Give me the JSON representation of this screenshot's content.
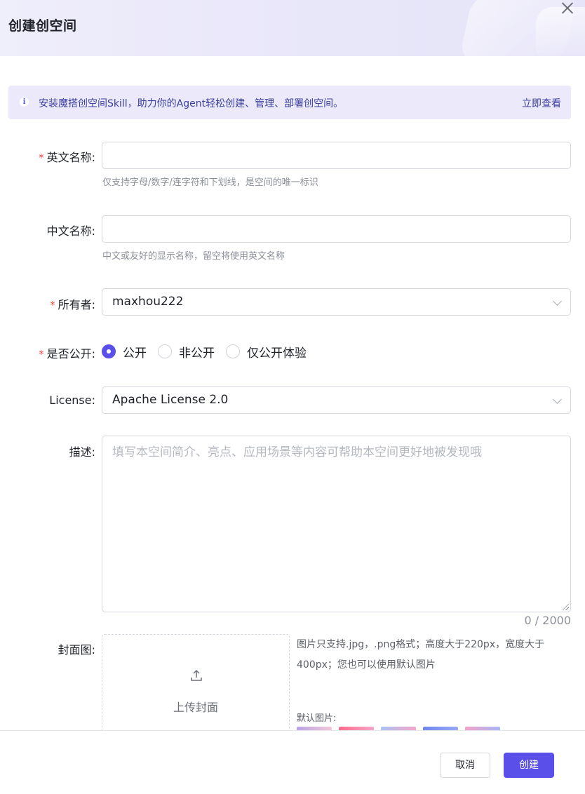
{
  "dialog": {
    "title": "创建创空间"
  },
  "notice": {
    "icon": "info-icon",
    "text": "安装魔搭创空间Skill，助力你的Agent轻松创建、管理、部署创空间。",
    "link": "立即查看"
  },
  "form": {
    "english_name": {
      "label": "英文名称:",
      "required": "*",
      "value": "",
      "hint": "仅支持字母/数字/连字符和下划线，是空间的唯一标识"
    },
    "chinese_name": {
      "label": "中文名称:",
      "value": "",
      "hint": "中文或友好的显示名称，留空将使用英文名称"
    },
    "owner": {
      "label": "所有者:",
      "required": "*",
      "value": "maxhou222"
    },
    "visibility": {
      "label": "是否公开:",
      "required": "*",
      "options": [
        "公开",
        "非公开",
        "仅公开体验"
      ],
      "selected": "公开"
    },
    "license": {
      "label": "License:",
      "value": "Apache License 2.0"
    },
    "description": {
      "label": "描述:",
      "placeholder": "填写本空间简介、亮点、应用场景等内容可帮助本空间更好地被发现哦",
      "counter": "0 / 2000"
    },
    "cover": {
      "label": "封面图:",
      "upload_text": "上传封面",
      "hint": "图片只支持.jpg，.png格式；高度大于220px，宽度大于400px；您也可以使用默认图片",
      "default_label": "默认图片:",
      "default_images": [
        {
          "name": "default-cover-1",
          "colors": [
            "#b9a3e8",
            "#f3c9d6"
          ]
        },
        {
          "name": "default-cover-2",
          "colors": [
            "#ff6b8a",
            "#f6a6c9"
          ]
        },
        {
          "name": "default-cover-3",
          "colors": [
            "#a9c4f5",
            "#f5a6c8"
          ]
        },
        {
          "name": "default-cover-4",
          "colors": [
            "#6f86f0",
            "#9aa9f7"
          ]
        },
        {
          "name": "default-cover-5",
          "colors": [
            "#f2a3c7",
            "#a9b6f5"
          ]
        }
      ]
    }
  },
  "footer": {
    "cancel": "取消",
    "create": "创建"
  },
  "colors": {
    "accent": "#5b4fe9",
    "required": "#f04b4b",
    "notice_bg": "#ebe9fa"
  }
}
